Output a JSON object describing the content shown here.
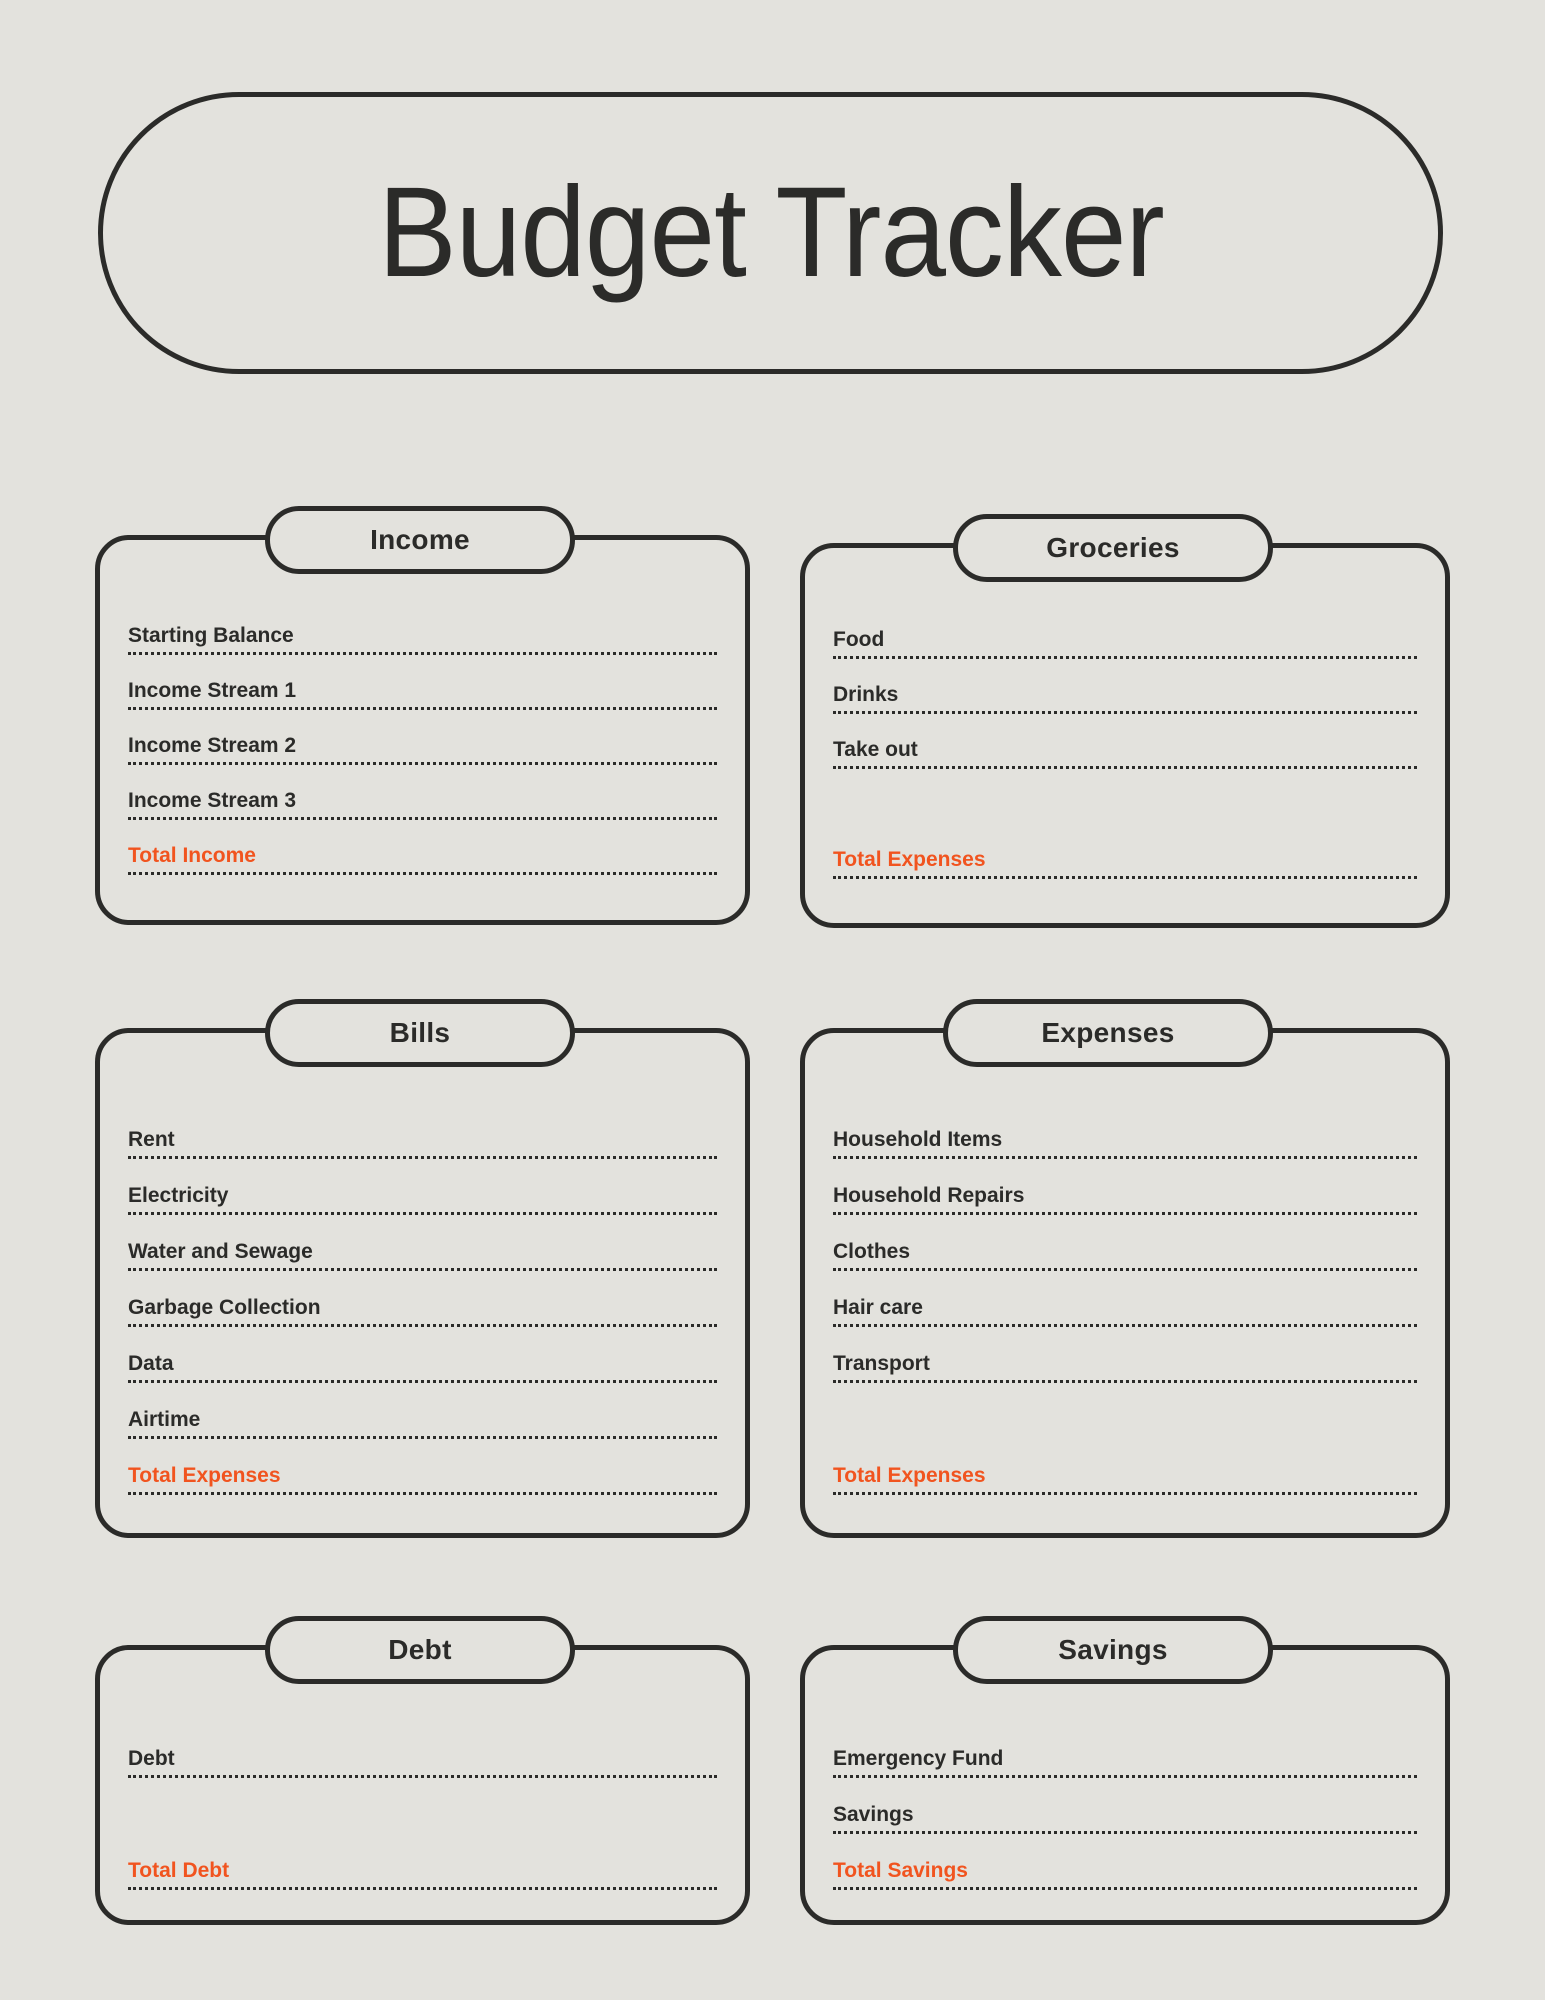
{
  "document": {
    "title": "Budget Tracker",
    "background_color": "#E3E2DD",
    "ink_color": "#2B2B29",
    "accent_color": "#F1541F"
  },
  "sections": [
    {
      "id": "income",
      "title": "Income",
      "rows": [
        {
          "label": "Starting Balance",
          "total": false
        },
        {
          "label": "Income Stream 1",
          "total": false
        },
        {
          "label": "Income Stream 2",
          "total": false
        },
        {
          "label": "Income Stream 3",
          "total": false
        },
        {
          "label": "Total Income",
          "total": true
        }
      ]
    },
    {
      "id": "groceries",
      "title": "Groceries",
      "rows": [
        {
          "label": "Food",
          "total": false
        },
        {
          "label": "Drinks",
          "total": false
        },
        {
          "label": "Take out",
          "total": false
        },
        {
          "label": "",
          "total": false,
          "spacer": true
        },
        {
          "label": "Total Expenses",
          "total": true
        }
      ]
    },
    {
      "id": "bills",
      "title": "Bills",
      "rows": [
        {
          "label": "Rent",
          "total": false
        },
        {
          "label": "Electricity",
          "total": false
        },
        {
          "label": "Water and Sewage",
          "total": false
        },
        {
          "label": "Garbage Collection",
          "total": false
        },
        {
          "label": "Data",
          "total": false
        },
        {
          "label": "Airtime",
          "total": false
        },
        {
          "label": "Total Expenses",
          "total": true
        }
      ]
    },
    {
      "id": "expenses",
      "title": "Expenses",
      "rows": [
        {
          "label": "Household Items",
          "total": false
        },
        {
          "label": "Household Repairs",
          "total": false
        },
        {
          "label": "Clothes",
          "total": false
        },
        {
          "label": "Hair care",
          "total": false
        },
        {
          "label": "Transport",
          "total": false
        },
        {
          "label": "",
          "total": false,
          "spacer": true
        },
        {
          "label": "Total Expenses",
          "total": true
        }
      ]
    },
    {
      "id": "debt",
      "title": "Debt",
      "rows": [
        {
          "label": "Debt",
          "total": false
        },
        {
          "label": "",
          "total": false,
          "spacer": true
        },
        {
          "label": "Total Debt",
          "total": true
        }
      ]
    },
    {
      "id": "savings",
      "title": "Savings",
      "rows": [
        {
          "label": "Emergency Fund",
          "total": false
        },
        {
          "label": "Savings",
          "total": false
        },
        {
          "label": "Total Savings",
          "total": true
        }
      ]
    }
  ]
}
